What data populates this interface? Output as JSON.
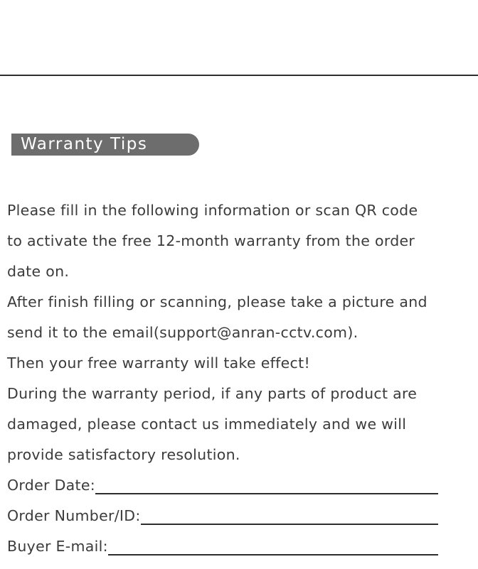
{
  "section": {
    "title": "Warranty Tips"
  },
  "paragraph_lines": [
    "Please fill in the following information or scan QR code",
    "to activate the free 12-month warranty from the order",
    "date on.",
    "After finish filling or scanning, please take a picture and",
    "send it to the email(support@anran-cctv.com).",
    "Then your free warranty will take effect!",
    "During the warranty period, if any parts of product are",
    "damaged, please contact us immediately and we will",
    "provide satisfactory resolution."
  ],
  "form_fields": [
    {
      "label": "Order Date:",
      "value": ""
    },
    {
      "label": "Order Number/ID:",
      "value": ""
    },
    {
      "label": "Buyer E-mail:",
      "value": ""
    }
  ]
}
